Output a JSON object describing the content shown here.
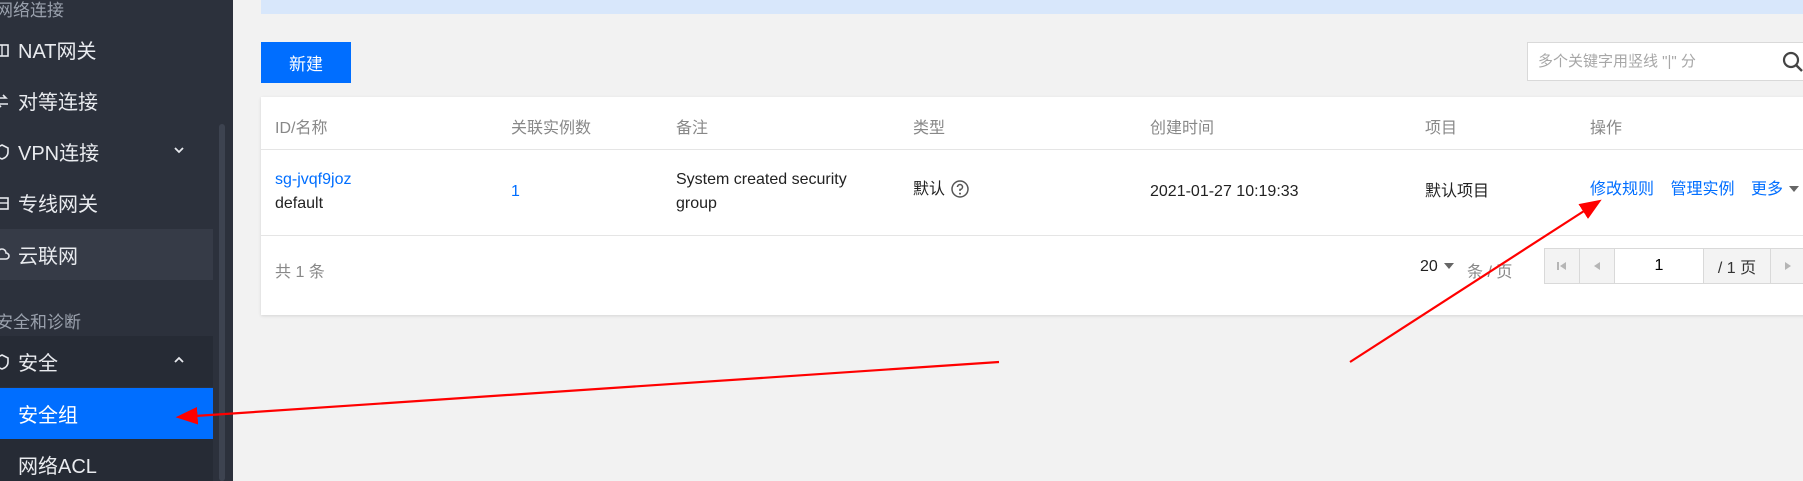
{
  "sidebar": {
    "group_network": "网络连接",
    "group_security": "安全和诊断",
    "items": [
      {
        "label": "NAT网关",
        "icon": "nat-gateway-icon"
      },
      {
        "label": "对等连接",
        "icon": "peering-icon"
      },
      {
        "label": "VPN连接",
        "icon": "vpn-shield-icon"
      },
      {
        "label": "专线网关",
        "icon": "direct-connect-icon"
      },
      {
        "label": "云联网",
        "icon": "cloud-network-icon"
      },
      {
        "label": "安全",
        "icon": "security-shield-icon"
      },
      {
        "label": "安全组"
      },
      {
        "label": "网络ACL"
      }
    ]
  },
  "toolbar": {
    "new_label": "新建",
    "search_placeholder": "多个关键字用竖线 \"|\" 分",
    "search_icon": "search-icon"
  },
  "table": {
    "headers": [
      "ID/名称",
      "关联实例数",
      "备注",
      "类型",
      "创建时间",
      "项目",
      "操作"
    ],
    "rows": [
      {
        "id": "sg-jvqf9joz",
        "name": "default",
        "instance_count": "1",
        "remark_line1": "System created security",
        "remark_line2": "group",
        "type": "默认",
        "created": "2021-01-27 10:19:33",
        "project": "默认项目",
        "actions": {
          "modify": "修改规则",
          "manage": "管理实例",
          "more": "更多"
        }
      }
    ]
  },
  "pagination": {
    "total": "共 1 条",
    "page_size": "20",
    "page_size_suffix": "条 / 页",
    "current_page": "1",
    "total_pages": "/ 1 页"
  },
  "colors": {
    "accent": "#006eff",
    "sidebar_bg": "#2c313c",
    "annotation": "#ff0000"
  }
}
